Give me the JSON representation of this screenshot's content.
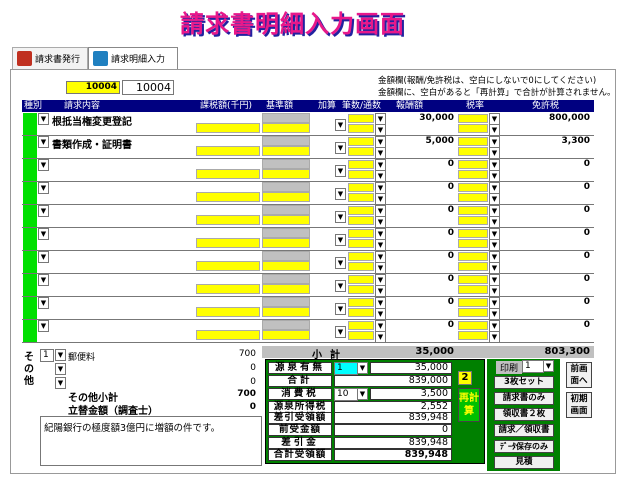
{
  "title": "請求書明細入力画面",
  "tabs": [
    {
      "label": "請求書発行"
    },
    {
      "label": "請求明細入力"
    }
  ],
  "id_field": {
    "highlight": "10004",
    "value": "10004"
  },
  "notes": [
    "金額欄(報酬/免許税は、空白にしないで0にしてください)",
    "金額欄に、空白があると「再計算」で合計が計算されません。"
  ],
  "headers": {
    "kind": "種別",
    "content": "請求内容",
    "taxable": "課税額(千円)",
    "base": "基準額",
    "add": "加算",
    "count": "筆数/通数",
    "fee": "報酬額",
    "rate": "税率",
    "license": "免許税"
  },
  "rows": [
    {
      "content": "根抵当権変更登記",
      "fee": "30,000",
      "license": "800,000"
    },
    {
      "content": "書類作成・証明書",
      "fee": "5,000",
      "license": "3,300"
    },
    {
      "content": "",
      "fee": "0",
      "license": "0"
    },
    {
      "content": "",
      "fee": "0",
      "license": "0"
    },
    {
      "content": "",
      "fee": "0",
      "license": "0"
    },
    {
      "content": "",
      "fee": "0",
      "license": "0"
    },
    {
      "content": "",
      "fee": "0",
      "license": "0"
    },
    {
      "content": "",
      "fee": "0",
      "license": "0"
    },
    {
      "content": "",
      "fee": "0",
      "license": "0"
    },
    {
      "content": "",
      "fee": "0",
      "license": "0"
    }
  ],
  "other": {
    "label": "その他",
    "items": [
      {
        "no": "1",
        "name": "郵便料",
        "value": "700"
      },
      {
        "no": "",
        "name": "",
        "value": "0"
      },
      {
        "no": "",
        "name": "",
        "value": "0"
      }
    ],
    "subtotal_label": "その他小計",
    "subtotal": "700",
    "transfer_label": "立替金額（調査士）",
    "transfer": "0"
  },
  "subtotal": {
    "label": "小計",
    "fee": "35,000",
    "license": "803,300"
  },
  "memo": "紀陽銀行の極度額3億円に増額の件です。",
  "summary": {
    "withholding": {
      "label": "源泉有無",
      "select": "1",
      "value": "35,000"
    },
    "total": {
      "label": "合計",
      "value": "839,000"
    },
    "tax": {
      "label": "消費税",
      "select": "10",
      "value": "3,500"
    },
    "income_tax": {
      "label": "源泉所得税",
      "value": "2,552"
    },
    "net": {
      "label": "差引受領額",
      "value": "839,948"
    },
    "advance": {
      "label": "前受金額",
      "value": "0"
    },
    "balance": {
      "label": "差引金",
      "value": "839,948"
    },
    "grand": {
      "label": "合計受領額",
      "value": "839,948"
    },
    "badge": "2",
    "recalc": "再計算"
  },
  "print": {
    "label": "印刷",
    "select": "1"
  },
  "buttons": {
    "set3": "3枚セット",
    "invoice_only": "請求書のみ",
    "receipt2": "領収書２枚",
    "inv_rec": "請求／領収書",
    "save": "ﾃﾞｰﾀ保存のみ",
    "estimate": "見積",
    "prev": "前画面へ",
    "init": "初期画面"
  }
}
